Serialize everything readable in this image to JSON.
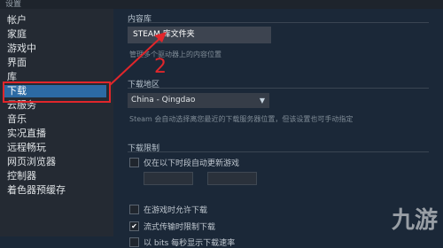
{
  "window": {
    "title": "设置"
  },
  "sidebar": {
    "items": [
      {
        "label": "帐户"
      },
      {
        "label": "家庭"
      },
      {
        "label": "游戏中"
      },
      {
        "label": "界面"
      },
      {
        "label": "库"
      },
      {
        "label": "下载",
        "active": true
      },
      {
        "label": "云服务"
      },
      {
        "label": "音乐"
      },
      {
        "label": "实况直播"
      },
      {
        "label": "远程畅玩"
      },
      {
        "label": "网页浏览器"
      },
      {
        "label": "控制器"
      },
      {
        "label": "着色器预缓存"
      }
    ]
  },
  "content_library": {
    "title": "内容库",
    "folder_button": "STEAM 库文件夹",
    "description": "管理多个驱动器上的内容位置"
  },
  "download_region": {
    "title": "下载地区",
    "selected": "China - Qingdao",
    "description": "Steam 会自动选择离您最近的下载服务器位置，但该设置也可手动指定"
  },
  "download_limits": {
    "title": "下载限制",
    "options": [
      {
        "label": "仅在以下时段自动更新游戏",
        "checked": false
      },
      {
        "label": "在游戏时允许下载",
        "checked": false
      },
      {
        "label": "流式传输时限制下载",
        "checked": true
      },
      {
        "label": "以 bits 每秒显示下载速率",
        "checked": false
      }
    ]
  },
  "annotations": {
    "marker_number": "2",
    "highlight_color": "#e0262b"
  },
  "watermark": {
    "text": "九游"
  },
  "colors": {
    "background": "#1b2838",
    "sidebar": "#242a33",
    "active_item": "#2c6aa4"
  }
}
